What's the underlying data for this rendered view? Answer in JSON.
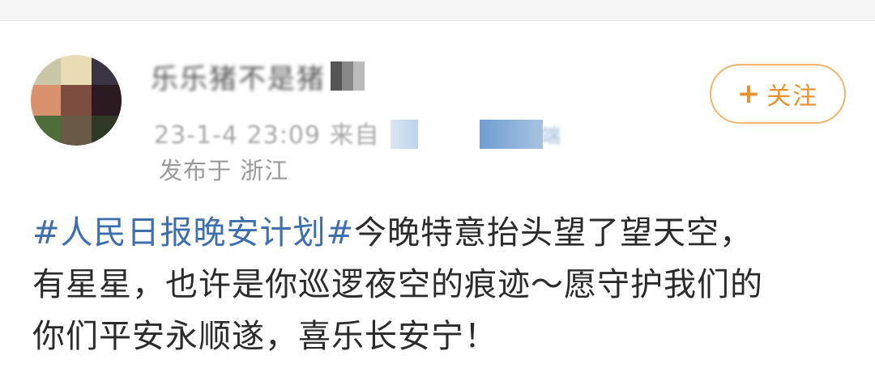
{
  "post": {
    "username": "乐乐猪不是猪",
    "timestamp": "23-1-4 23:09 来自",
    "source_suffix": "端",
    "location": "发布于 浙江",
    "follow_button": {
      "icon": "plus-icon",
      "label": "关注"
    },
    "hashtag": "#人民日报晚安计划#",
    "lines": [
      "今晚特意抬头望了望天空，",
      "有星星，也许是你巡逻夜空的痕迹～愿守护我们的",
      "你们平安永顺遂，喜乐长安宁！"
    ]
  },
  "colors": {
    "hashtag": "#3d6fae",
    "follow_accent": "#e8912e",
    "follow_border": "#f1b46c",
    "meta_text": "#9a9a9a"
  }
}
